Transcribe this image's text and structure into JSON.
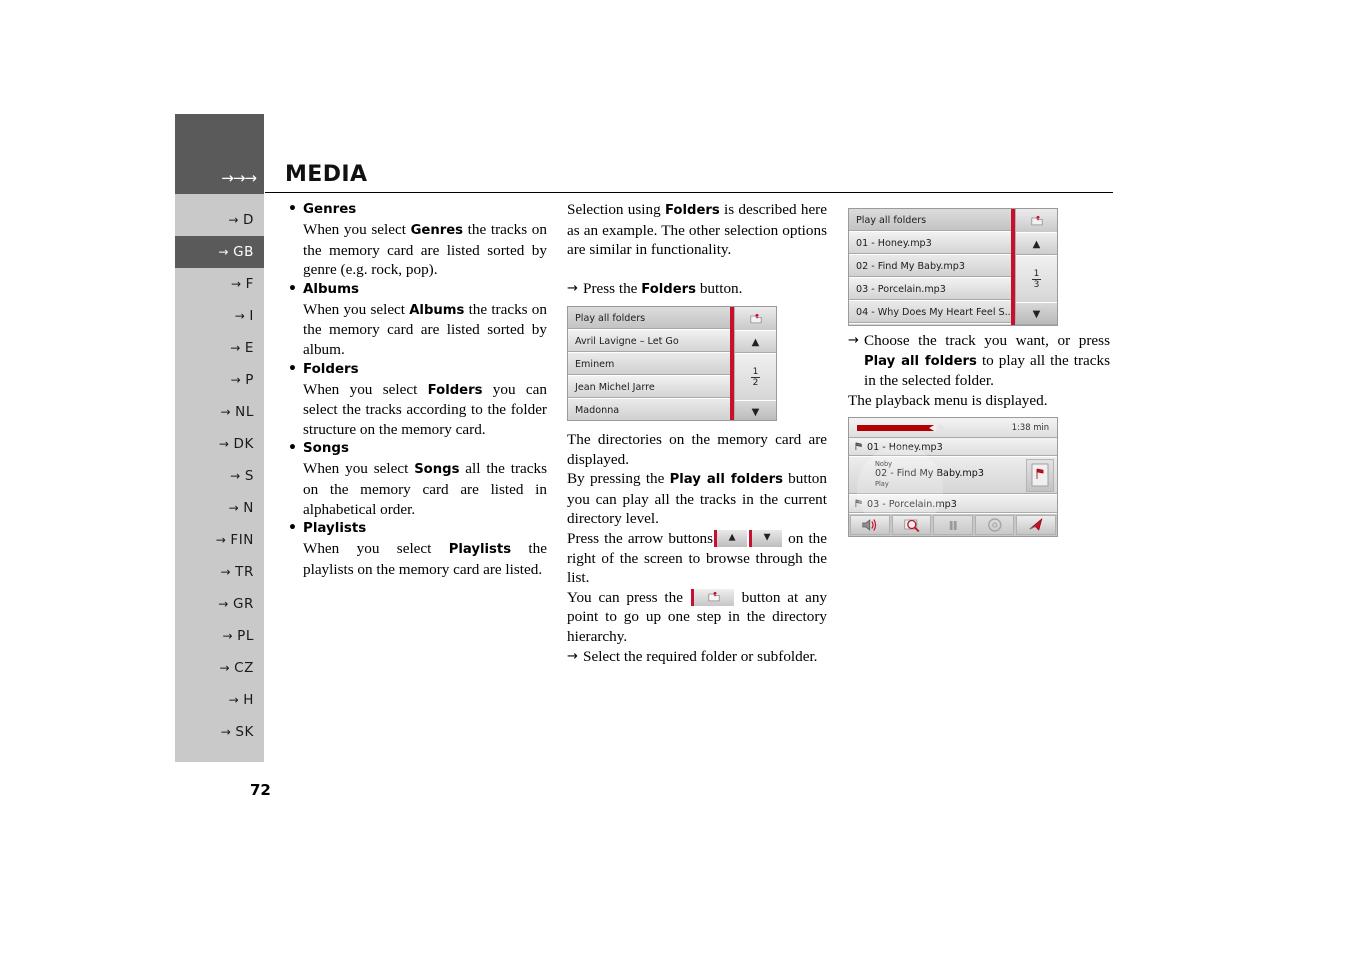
{
  "sidebar": {
    "arrows": "→→→",
    "items": [
      {
        "label": "D",
        "active": false
      },
      {
        "label": "GB",
        "active": true
      },
      {
        "label": "F",
        "active": false
      },
      {
        "label": "I",
        "active": false
      },
      {
        "label": "E",
        "active": false
      },
      {
        "label": "P",
        "active": false
      },
      {
        "label": "NL",
        "active": false
      },
      {
        "label": "DK",
        "active": false
      },
      {
        "label": "S",
        "active": false
      },
      {
        "label": "N",
        "active": false
      },
      {
        "label": "FIN",
        "active": false
      },
      {
        "label": "TR",
        "active": false
      },
      {
        "label": "GR",
        "active": false
      },
      {
        "label": "PL",
        "active": false
      },
      {
        "label": "CZ",
        "active": false
      },
      {
        "label": "H",
        "active": false
      },
      {
        "label": "SK",
        "active": false
      }
    ]
  },
  "header": {
    "title": "MEDIA"
  },
  "page_number": "72",
  "column1": {
    "entries": [
      {
        "term": "Genres",
        "body_pre": "When you select ",
        "body_bold": "Genres",
        "body_post": " the tracks on the memory card are listed sorted by genre (e.g. rock, pop)."
      },
      {
        "term": "Albums",
        "body_pre": "When you select ",
        "body_bold": "Albums",
        "body_post": " the tracks on the memory card are listed sorted by album."
      },
      {
        "term": "Folders",
        "body_pre": "When you select ",
        "body_bold": "Folders",
        "body_post": " you can select the tracks according to the folder structure on the memory card."
      },
      {
        "term": "Songs",
        "body_pre": "When you select ",
        "body_bold": "Songs",
        "body_post": " all the tracks on the memory card are listed in alphabetical order."
      },
      {
        "term": "Playlists",
        "body_pre": "When you select ",
        "body_bold": "Playlists",
        "body_post": " the playlists on the memory card are listed."
      }
    ]
  },
  "column2": {
    "intro_pre": "Selection using ",
    "intro_bold": "Folders",
    "intro_post": " is described here as an example. The other selection options are similar in functionality.",
    "step_press_pre": "Press the ",
    "step_press_bold": "Folders",
    "step_press_post": " button.",
    "after_pre": "The directories on the memory card are displayed.",
    "after2_pre": "By pressing the ",
    "after2_bold": "Play all folders",
    "after2_post": " button you can play all the tracks in the current directory level.",
    "arrows_pre": "Press the arrow buttons",
    "arrows_post": "on the right of the screen to browse through the list.",
    "updir_pre": "You can press the",
    "updir_post": "button at any point to go up one step in the directory hierarchy.",
    "step_select": "Select the required folder or subfolder."
  },
  "column3": {
    "choose_pre": "Choose the track you want, or press ",
    "choose_bold": "Play all folders",
    "choose_post": " to play all the tracks in the selected folder.",
    "playback_note": "The playback menu is displayed."
  },
  "device_folders": {
    "rows": [
      {
        "label": "Play all folders",
        "style": "head"
      },
      {
        "label": "Avril Lavigne – Let Go",
        "style": "normal"
      },
      {
        "label": "Eminem",
        "style": "dim"
      },
      {
        "label": "Jean Michel Jarre",
        "style": "normal"
      },
      {
        "label": "Madonna",
        "style": "dim"
      }
    ],
    "up_icon": "folder-up-icon",
    "scroll_up": "▲",
    "scroll_down": "▼",
    "page_num": "1",
    "page_den": "2"
  },
  "device_tracks": {
    "rows": [
      {
        "label": "Play all folders",
        "style": "head"
      },
      {
        "label": "01 - Honey.mp3",
        "style": "normal"
      },
      {
        "label": "02 - Find My Baby.mp3",
        "style": "dim"
      },
      {
        "label": "03 - Porcelain.mp3",
        "style": "normal"
      },
      {
        "label": "04 - Why Does My Heart Feel S..",
        "style": "dim"
      }
    ],
    "up_icon": "folder-up-icon",
    "scroll_up": "▲",
    "scroll_down": "▼",
    "page_num": "1",
    "page_den": "3"
  },
  "device_playback": {
    "time": "1:38 min",
    "track_above": "01 - Honey.mp3",
    "current_artist": "Noby",
    "current_title": "02 - Find My Baby.mp3",
    "current_state": "Play",
    "track_below": "03 - Porcelain.mp3",
    "toolbar": [
      {
        "icon": "speaker-volume-icon"
      },
      {
        "icon": "map-search-icon"
      },
      {
        "icon": "pause-icon"
      },
      {
        "icon": "disc-icon"
      },
      {
        "icon": "navigation-arrow-icon"
      }
    ]
  },
  "colors": {
    "rail_dark": "#5a5a5a",
    "rail_light": "#c9c9c9",
    "accent_red": "#c8102e",
    "progress_red": "#b20000"
  }
}
